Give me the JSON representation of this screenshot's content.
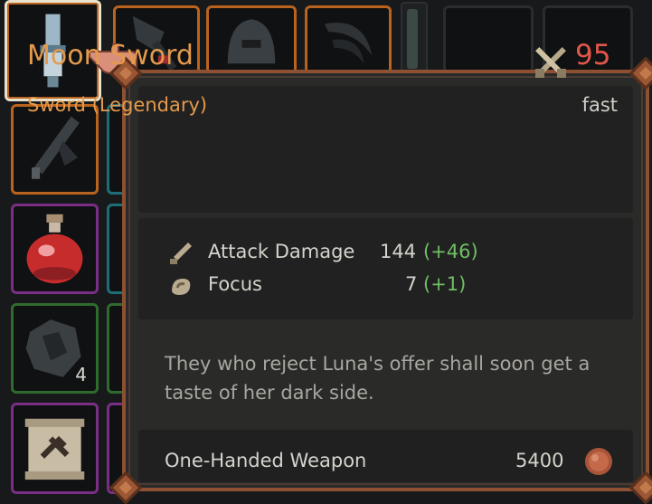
{
  "inventory": {
    "slots": [
      {
        "name": "slot-hilt",
        "icon": "sword-hilt-icon",
        "rarity": "selected"
      },
      {
        "name": "slot-axe",
        "icon": "axe-icon",
        "rarity": "orange"
      },
      {
        "name": "slot-helmet",
        "icon": "helmet-icon",
        "rarity": "orange"
      },
      {
        "name": "slot-scythe",
        "icon": "scythe-icon",
        "rarity": "orange"
      },
      {
        "name": "slot-moon-sword",
        "icon": "dark-sword-icon",
        "rarity": "orange"
      },
      {
        "name": "slot-potion",
        "icon": "health-potion-icon",
        "rarity": "purple"
      },
      {
        "name": "slot-ore",
        "icon": "ore-icon",
        "rarity": "green",
        "count": "4"
      },
      {
        "name": "slot-scroll",
        "icon": "scroll-icon",
        "rarity": "purple"
      }
    ]
  },
  "tooltip": {
    "item_name": "Moon Sword",
    "item_type": "Sword (Legendary)",
    "damage": "95",
    "damage_icon": "crossed-swords-icon",
    "speed": "fast",
    "stats": [
      {
        "label": "Attack Damage",
        "value": "144",
        "bonus": "(+46)",
        "icon": "sword-stat-icon"
      },
      {
        "label": "Focus",
        "value": "7",
        "bonus": "(+1)",
        "icon": "focus-stat-icon"
      }
    ],
    "description": "They who reject Luna's offer shall soon get a taste of her dark side.",
    "category": "One-Handed Weapon",
    "price": "5400",
    "price_icon": "copper-coin-icon"
  },
  "colors": {
    "name": "#e49a4c",
    "damage": "#e0574a",
    "bonus": "#6fbf64",
    "border": "#8e5033"
  }
}
